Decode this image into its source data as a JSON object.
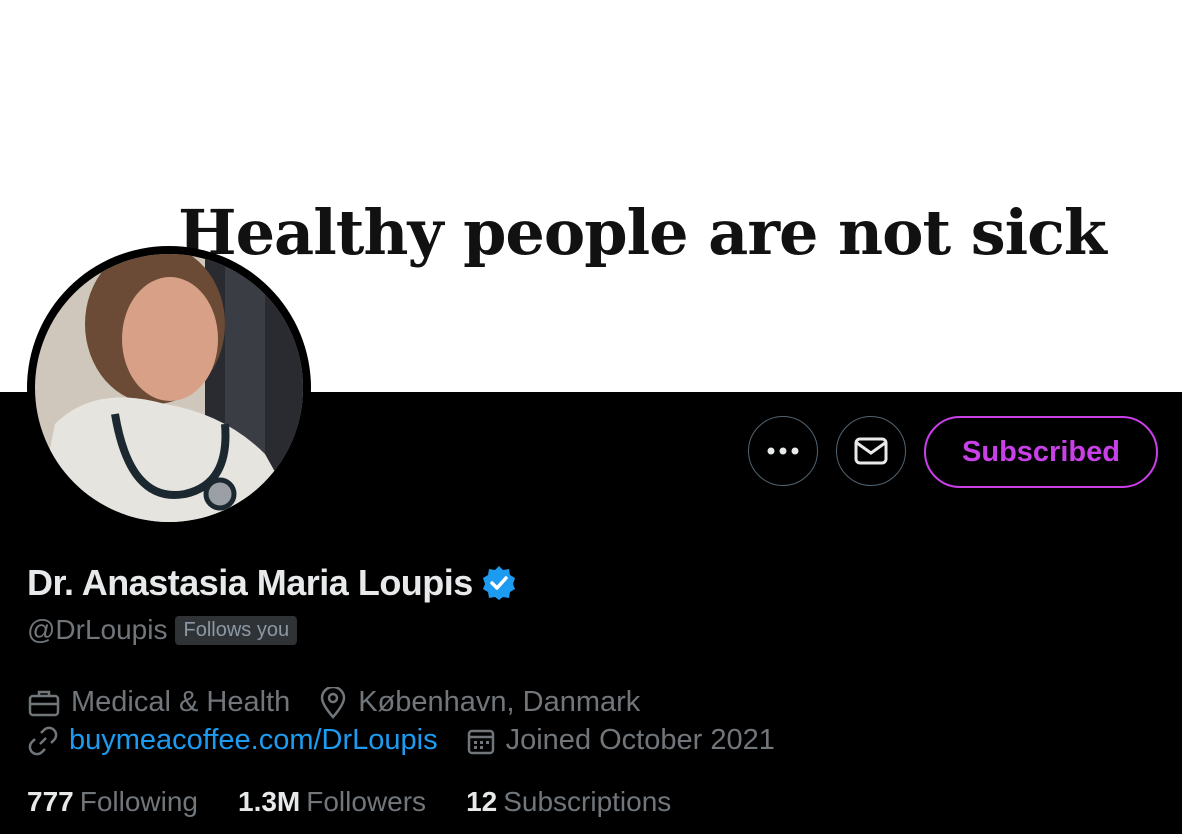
{
  "banner": {
    "text": "Healthy people are not sick"
  },
  "profile": {
    "display_name": "Dr. Anastasia Maria Loupis",
    "handle": "@DrLoupis",
    "follows_you": "Follows you",
    "category": "Medical & Health",
    "location": "København, Danmark",
    "website": "buymeacoffee.com/DrLoupis",
    "joined": "Joined October 2021"
  },
  "actions": {
    "more_icon": "more-dots-icon",
    "message_icon": "envelope-icon",
    "subscribed_label": "Subscribed"
  },
  "stats": {
    "following_count": "777",
    "following_label": "Following",
    "followers_count": "1.3M",
    "followers_label": "Followers",
    "subscriptions_count": "12",
    "subscriptions_label": "Subscriptions"
  },
  "colors": {
    "background": "#000000",
    "accent_purple": "#c93fe8",
    "link_blue": "#1d9bf0",
    "verified_blue": "#1d9bf0",
    "muted_text": "#71767b"
  }
}
